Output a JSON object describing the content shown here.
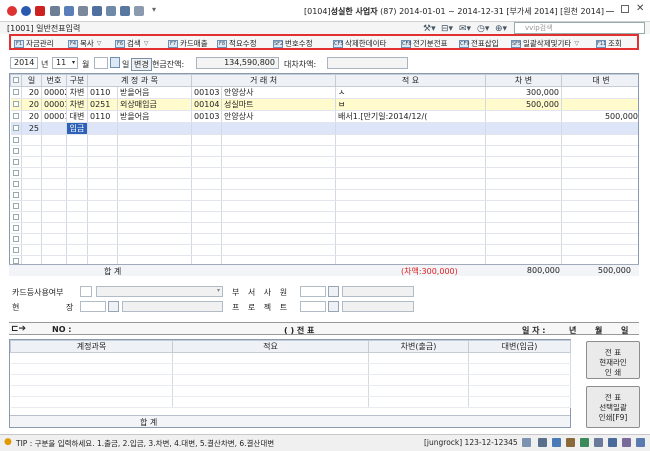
{
  "window": {
    "title_code": "[0104]",
    "company": "성실한 사업자",
    "info": "(87) 2014-01-01 ~ 2014-12-31 [부가세 2014] [원천 2014]",
    "search_placeholder": "vvip검색"
  },
  "screen": {
    "title": "[1001] 일반전표입력"
  },
  "toolbar": [
    {
      "key": "F1",
      "label": "자금관리"
    },
    {
      "key": "F4",
      "label": "복사",
      "dropdown": true
    },
    {
      "key": "F6",
      "label": "검색",
      "dropdown": true
    },
    {
      "key": "F7",
      "label": "카드매출"
    },
    {
      "key": "F8",
      "label": "적요수정"
    },
    {
      "key": "SF2",
      "label": "번호수정"
    },
    {
      "key": "CF5",
      "label": "삭제한데이타"
    },
    {
      "key": "CF8",
      "label": "전기분전표"
    },
    {
      "key": "CF9",
      "label": "전표삽입"
    },
    {
      "key": "SF5",
      "label": "일괄삭제및기타",
      "dropdown": true
    },
    {
      "key": "F11",
      "label": "조회"
    }
  ],
  "filter": {
    "year": "2014",
    "year_label": "년",
    "month": "11",
    "month_label": "월",
    "day_label": "일",
    "change_label": "변경",
    "cash_label": "현금잔액:",
    "cash_value": "134,590,800",
    "diff_label": "대차차액:"
  },
  "grid": {
    "headers": [
      "일",
      "번호",
      "구분",
      "계 정 과 목",
      "거 래 처",
      "적 요",
      "차 변",
      "대 변"
    ],
    "rows": [
      {
        "day": "20",
        "no": "00002",
        "type": "차변",
        "acct_code": "0110",
        "acct": "받을어음",
        "cust_code": "00103",
        "cust": "안양상사",
        "memo": "ㅅ",
        "debit": "300,000",
        "credit": ""
      },
      {
        "day": "20",
        "no": "00001",
        "type": "차변",
        "acct_code": "0251",
        "acct": "외상매입금",
        "cust_code": "00104",
        "cust": "성실마트",
        "memo": "ㅂ",
        "debit": "500,000",
        "credit": ""
      },
      {
        "day": "20",
        "no": "00001",
        "type": "대변",
        "acct_code": "0110",
        "acct": "받을어음",
        "cust_code": "00103",
        "cust": "안양상사",
        "memo": "배서1.[만기일:2014/12/(",
        "debit": "",
        "credit": "500,000"
      },
      {
        "day": "25",
        "no": "",
        "type": "입금",
        "acct_code": "",
        "acct": "",
        "cust_code": "",
        "cust": "",
        "memo": "",
        "debit": "",
        "credit": ""
      }
    ],
    "totals": {
      "label": "합          계",
      "diff": "(차액:300,000)",
      "debit": "800,000",
      "credit": "500,000"
    }
  },
  "card_section": {
    "card_label": "카드등사용여부",
    "hyun": "현",
    "jang": "장",
    "dept_label": "부 서 사 원",
    "project_label": "프 로 젝 트"
  },
  "journal_bar": {
    "no_label": "NO :",
    "paren": "(          ) 전  표",
    "date_label": "일 자 :",
    "y": "년",
    "m": "월",
    "d": "일"
  },
  "lower_grid": {
    "headers": [
      "계정과목",
      "적요",
      "차변(출금)",
      "대변(입금)"
    ],
    "total_label": "합          계"
  },
  "side_buttons": [
    {
      "lines": [
        "전       표",
        "현재라인",
        "인       쇄"
      ]
    },
    {
      "lines": [
        "전       표",
        "선택일괄",
        "인쇄[F9]"
      ]
    }
  ],
  "status": {
    "tip": "TIP : 구분을 입력하세요. 1.출금, 2.입금, 3.차변, 4.대변, 5.결산차변, 6.결산대변",
    "user": "[jungrock] 123-12-12345"
  }
}
